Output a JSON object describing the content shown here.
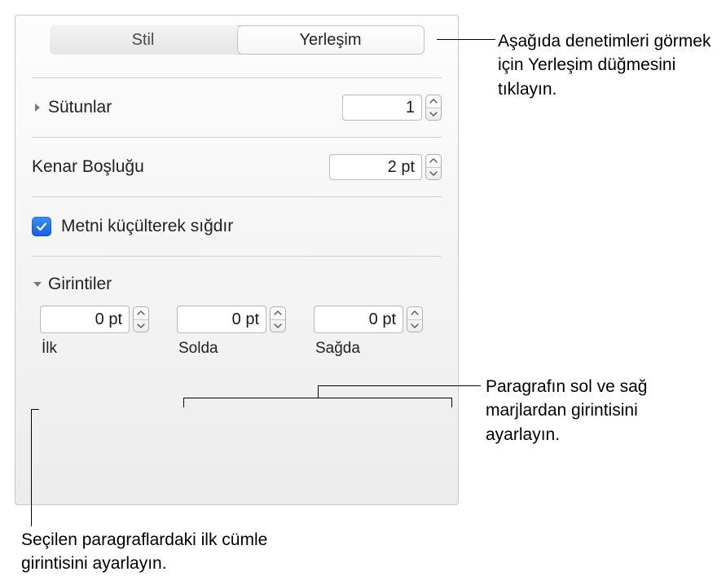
{
  "tabs": {
    "style": "Stil",
    "layout": "Yerleşim"
  },
  "columns": {
    "label": "Sütunlar",
    "value": "1"
  },
  "margin": {
    "label": "Kenar Boşluğu",
    "value": "2 pt"
  },
  "shrink": {
    "label": "Metni küçülterek sığdır",
    "checked": true
  },
  "indents": {
    "label": "Girintiler",
    "first": {
      "value": "0 pt",
      "label": "İlk"
    },
    "left": {
      "value": "0 pt",
      "label": "Solda"
    },
    "right": {
      "value": "0 pt",
      "label": "Sağda"
    }
  },
  "callouts": {
    "layout_tab": "Aşağıda denetimleri görmek için Yerleşim düğmesini tıklayın.",
    "lr_indent": "Paragrafın sol ve sağ marjlardan girintisini ayarlayın.",
    "first_indent": "Seçilen paragraflardaki ilk cümle girintisini ayarlayın."
  }
}
